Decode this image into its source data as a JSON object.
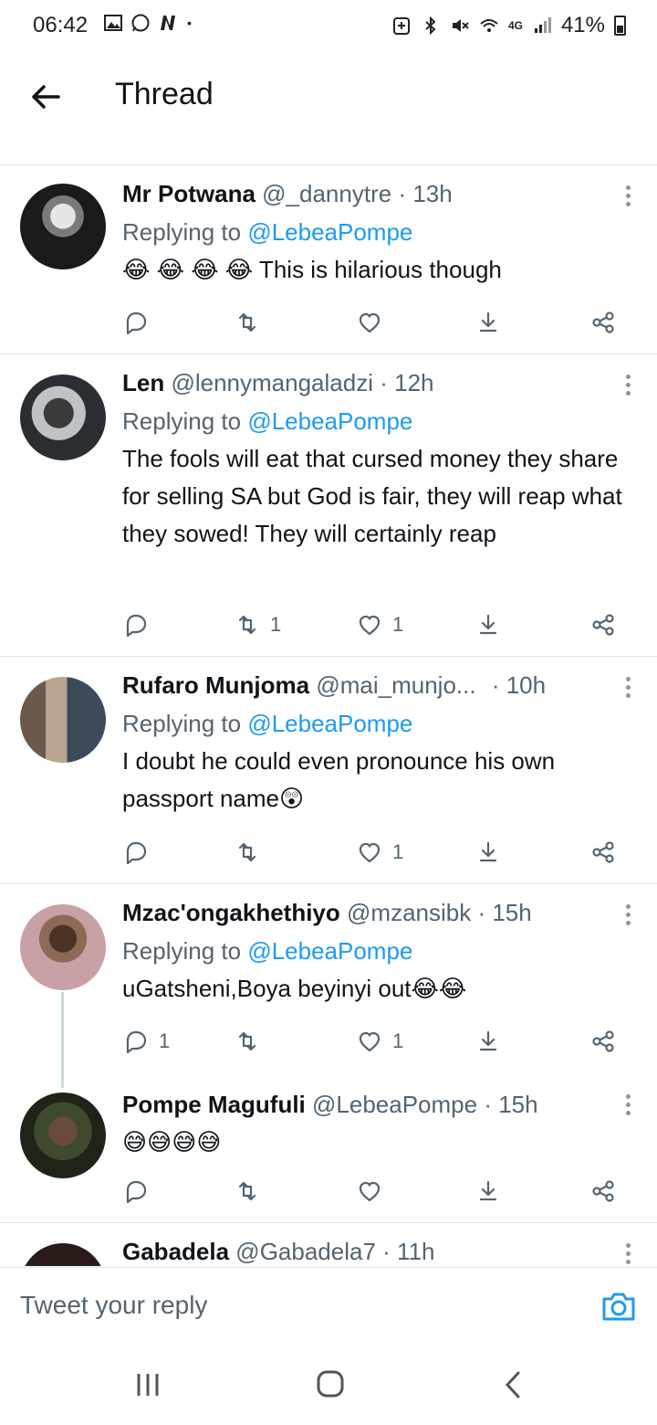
{
  "status_bar": {
    "time": "06:42",
    "battery": "41%",
    "network": "4G",
    "icons": [
      "gallery-icon",
      "whatsapp-icon",
      "n-icon",
      "dot-icon",
      "battery-saver-icon",
      "bluetooth-icon",
      "mute-icon",
      "wifi-icon",
      "signal-icon",
      "battery-icon"
    ]
  },
  "header": {
    "title": "Thread",
    "back_icon": "back-arrow-icon"
  },
  "tweets": [
    {
      "name": "Mr Potwana",
      "handle": "@_dannytre",
      "time": "· 13h",
      "replying_prefix": "Replying to",
      "mention": "@LebeaPompe",
      "text": "😂 😂 😂 😂 This is hilarious though",
      "reply_count": "",
      "retweet_count": "",
      "like_count": ""
    },
    {
      "name": "Len",
      "handle": "@lennymangaladzi",
      "time": "· 12h",
      "replying_prefix": "Replying to",
      "mention": "@LebeaPompe",
      "text": "The fools will eat that cursed money they share for selling SA but God is fair, they will reap what they sowed! They will certainly reap",
      "reply_count": "",
      "retweet_count": "1",
      "like_count": "1"
    },
    {
      "name": "Rufaro Munjoma",
      "handle": "@mai_munjo...",
      "time": "· 10h",
      "replying_prefix": "Replying to",
      "mention": "@LebeaPompe",
      "text": "I doubt he could even pronounce his own passport name😲",
      "reply_count": "",
      "retweet_count": "",
      "like_count": "1"
    },
    {
      "name": "Mzac'ongakhethiyo",
      "handle": "@mzansibk",
      "time": "· 15h",
      "replying_prefix": "Replying to",
      "mention": "@LebeaPompe",
      "text": "uGatsheni,Boya beyinyi out😂😂",
      "reply_count": "1",
      "retweet_count": "",
      "like_count": "1"
    },
    {
      "name": "Pompe Magufuli",
      "handle": "@LebeaPompe",
      "time": "· 15h",
      "text": "😅😅😅😅",
      "reply_count": "",
      "retweet_count": "",
      "like_count": ""
    },
    {
      "name": "Gabadela",
      "handle": "@Gabadela7",
      "time": "· 11h"
    }
  ],
  "reply_bar": {
    "placeholder": "Tweet your reply",
    "camera_icon": "camera-icon"
  },
  "nav_bar": {
    "icons": [
      "recent-apps-icon",
      "home-icon",
      "back-icon"
    ]
  },
  "colors": {
    "link": "#1d9bf0",
    "secondary_text": "#536471",
    "divider": "#e1e6ea"
  }
}
